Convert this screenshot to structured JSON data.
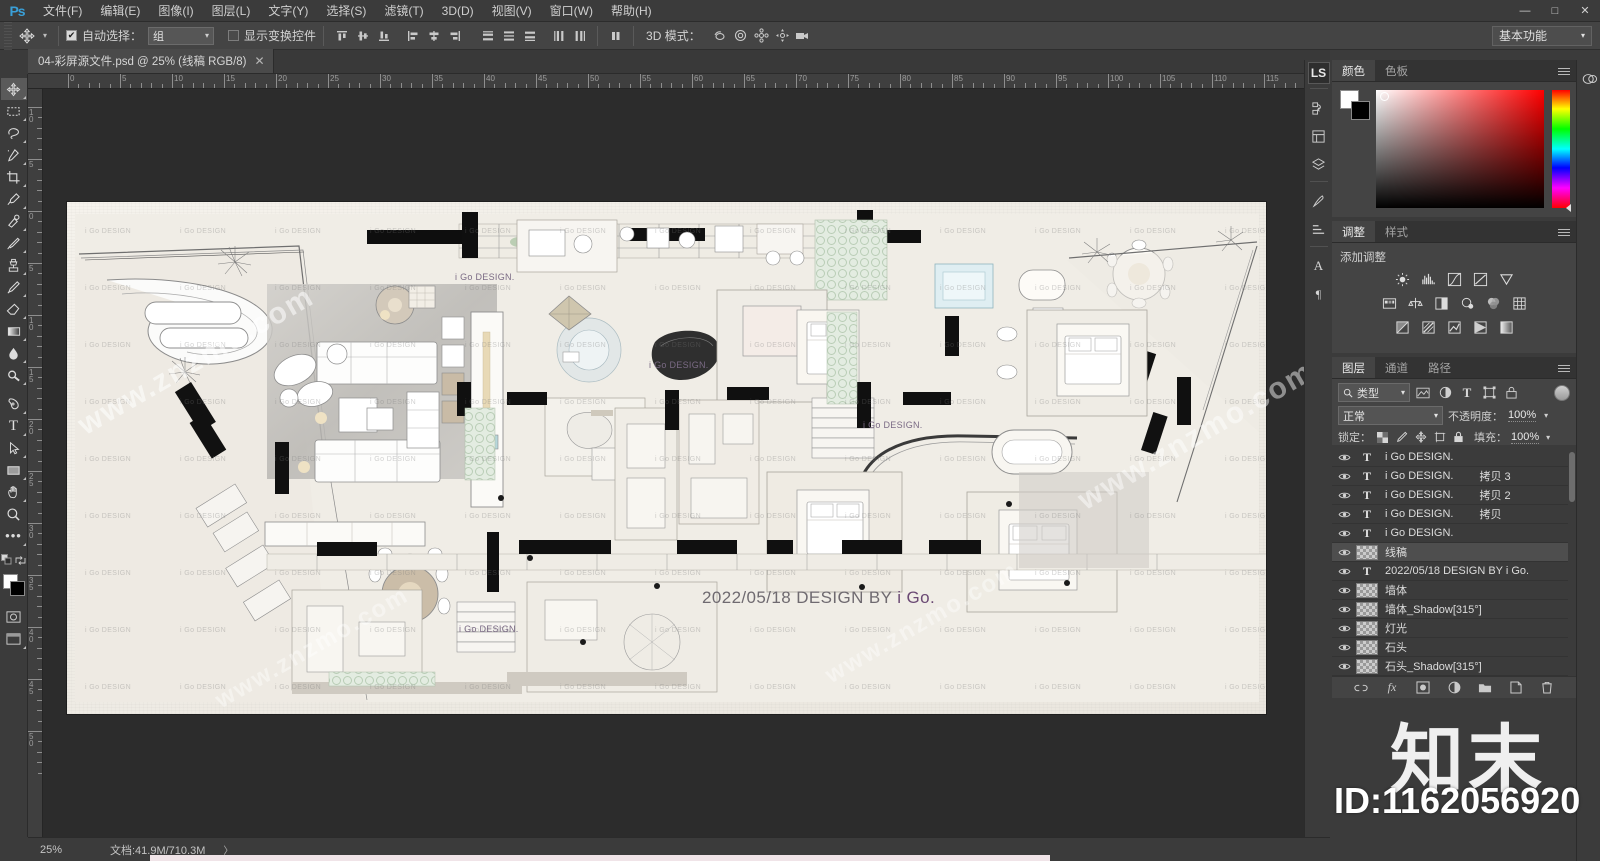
{
  "app": {
    "name": "Photoshop",
    "logo": "Ps"
  },
  "menubar": {
    "items": [
      {
        "label": "文件(F)"
      },
      {
        "label": "编辑(E)"
      },
      {
        "label": "图像(I)"
      },
      {
        "label": "图层(L)"
      },
      {
        "label": "文字(Y)"
      },
      {
        "label": "选择(S)"
      },
      {
        "label": "滤镜(T)"
      },
      {
        "label": "3D(D)"
      },
      {
        "label": "视图(V)"
      },
      {
        "label": "窗口(W)"
      },
      {
        "label": "帮助(H)"
      }
    ],
    "window_controls": [
      "—",
      "□",
      "✕"
    ]
  },
  "options_bar": {
    "active_tool_icon": "move-tool-icon",
    "auto_select_checked": true,
    "auto_select_label": "自动选择：",
    "auto_select_value": "组",
    "show_transform_label": "显示变换控件",
    "show_transform_checked": false,
    "three_d_label": "3D 模式：",
    "workspace": "基本功能",
    "align_icons": [
      "align-top-edges-icon",
      "align-vertical-centers-icon",
      "align-bottom-edges-icon",
      "align-left-edges-icon",
      "align-horizontal-centers-icon",
      "align-right-edges-icon",
      "distribute-top-icon",
      "distribute-vertical-center-icon",
      "distribute-bottom-icon",
      "distribute-left-icon",
      "distribute-right-icon"
    ],
    "extra_icons": [
      "align-options-icon"
    ],
    "three_d_icons": [
      "3d-orbit-icon",
      "3d-roll-icon",
      "3d-pan-icon",
      "3d-slide-icon",
      "3d-camera-icon"
    ]
  },
  "document_tab": {
    "title": "04-彩屏源文件.psd @ 25% (线稿  RGB/8)",
    "close": "✕"
  },
  "toolbar": {
    "tools": [
      {
        "name": "move-tool",
        "selected": true
      },
      {
        "name": "rectangular-marquee-tool",
        "selected": false
      },
      {
        "name": "lasso-tool",
        "selected": false
      },
      {
        "name": "quick-selection-tool",
        "selected": false
      },
      {
        "name": "crop-tool",
        "selected": false
      },
      {
        "name": "eyedropper-tool",
        "selected": false
      },
      {
        "name": "spot-healing-brush-tool",
        "selected": false
      },
      {
        "name": "brush-tool",
        "selected": false
      },
      {
        "name": "clone-stamp-tool",
        "selected": false
      },
      {
        "name": "history-brush-tool",
        "selected": false
      },
      {
        "name": "eraser-tool",
        "selected": false
      },
      {
        "name": "gradient-tool",
        "selected": false
      },
      {
        "name": "blur-tool",
        "selected": false
      },
      {
        "name": "dodge-tool",
        "selected": false
      },
      {
        "name": "pen-tool",
        "selected": false
      },
      {
        "name": "horizontal-type-tool",
        "selected": false
      },
      {
        "name": "path-selection-tool",
        "selected": false
      },
      {
        "name": "rectangle-tool",
        "selected": false
      },
      {
        "name": "hand-tool",
        "selected": false
      },
      {
        "name": "zoom-tool",
        "selected": false
      },
      {
        "name": "edit-toolbar-tool",
        "selected": false
      }
    ],
    "foreground_color": "#ffffff",
    "background_color": "#000000"
  },
  "rulers": {
    "unit_spacing_px": 52,
    "horizontal_labels": [
      "0",
      "5",
      "10",
      "15",
      "20",
      "25",
      "30",
      "35",
      "40",
      "45",
      "50",
      "55",
      "60",
      "65",
      "70",
      "75",
      "80",
      "85",
      "90",
      "95",
      "100",
      "105",
      "110",
      "115"
    ],
    "vertical_labels": [
      "10",
      "5",
      "0",
      "5",
      "10",
      "15",
      "20",
      "25",
      "30",
      "35",
      "40",
      "45",
      "50"
    ]
  },
  "canvas": {
    "credit_text": "2022/05/18 DESIGN BY ",
    "credit_brand": "i Go.",
    "watermark_text": "i Go DESIGN",
    "plan_labels": [
      "i Go DESIGN.",
      "i Go DESIGN.",
      "i Go DESIGN.",
      "i Go DESIGN."
    ],
    "site_watermark": "www.znzmo.com",
    "big_watermark": "知末"
  },
  "status_bar": {
    "zoom": "25%",
    "doc_info": "文档:41.9M/710.3M",
    "arrow": "〉"
  },
  "right_strip": {
    "items": [
      {
        "name": "libraries-badge",
        "label": "LS"
      },
      {
        "name": "history-icon"
      },
      {
        "name": "properties-icon"
      },
      {
        "name": "layer-comps-icon"
      },
      {
        "name": "brush-settings-icon"
      },
      {
        "name": "character-panel-icon",
        "label": "A"
      },
      {
        "name": "paragraph-panel-icon",
        "label": "¶"
      }
    ],
    "cc_libraries_icon": "creative-cloud-icon"
  },
  "color_panel": {
    "tabs": [
      {
        "label": "颜色",
        "active": true
      },
      {
        "label": "色板",
        "active": false
      }
    ],
    "foreground": "#ffffff",
    "background": "#000000"
  },
  "adjustments_panel": {
    "tabs": [
      {
        "label": "调整",
        "active": true
      },
      {
        "label": "样式",
        "active": false
      }
    ],
    "title": "添加调整",
    "row1": [
      "brightness-contrast-icon",
      "levels-icon",
      "curves-icon",
      "exposure-icon",
      "vibrance-icon"
    ],
    "row2": [
      "hue-saturation-icon",
      "color-balance-icon",
      "black-white-icon",
      "photo-filter-icon",
      "channel-mixer-icon",
      "color-lookup-icon"
    ],
    "row3": [
      "invert-icon",
      "posterize-icon",
      "threshold-icon",
      "gradient-map-icon",
      "selective-color-icon"
    ]
  },
  "layers_panel": {
    "tabs": [
      {
        "label": "图层",
        "active": true
      },
      {
        "label": "通道",
        "active": false
      },
      {
        "label": "路径",
        "active": false
      }
    ],
    "filter_label": "类型",
    "filter_icons": [
      "filter-pixel-icon",
      "filter-adjustment-icon",
      "filter-type-icon",
      "filter-shape-icon",
      "filter-smart-icon"
    ],
    "blend_mode": "正常",
    "opacity_label": "不透明度：",
    "opacity_value": "100%",
    "lock_label": "锁定：",
    "lock_icons": [
      "lock-transparent-pixels-icon",
      "lock-image-pixels-icon",
      "lock-position-icon",
      "lock-artboard-nesting-icon",
      "lock-all-icon"
    ],
    "fill_label": "填充：",
    "fill_value": "100%",
    "layers": [
      {
        "name": "i Go DESIGN.",
        "copy": "",
        "kind": "text",
        "visible": true,
        "selected": false
      },
      {
        "name": "i Go DESIGN.",
        "copy": "拷贝 3",
        "kind": "text",
        "visible": true,
        "selected": false
      },
      {
        "name": "i Go DESIGN.",
        "copy": "拷贝 2",
        "kind": "text",
        "visible": true,
        "selected": false
      },
      {
        "name": "i Go DESIGN.",
        "copy": "拷贝",
        "kind": "text",
        "visible": true,
        "selected": false
      },
      {
        "name": "i Go DESIGN.",
        "copy": "",
        "kind": "text",
        "visible": true,
        "selected": false
      },
      {
        "name": "线稿",
        "copy": "",
        "kind": "pixel",
        "visible": true,
        "selected": true
      },
      {
        "name": "2022/05/18 DESIGN BY i Go.",
        "copy": "",
        "kind": "text",
        "visible": true,
        "selected": false
      },
      {
        "name": "墙体",
        "copy": "",
        "kind": "pixel",
        "visible": true,
        "selected": false
      },
      {
        "name": "墙体_Shadow[315°]",
        "copy": "",
        "kind": "pixel",
        "visible": true,
        "selected": false
      },
      {
        "name": "灯光",
        "copy": "",
        "kind": "pixel",
        "visible": true,
        "selected": false
      },
      {
        "name": "石头",
        "copy": "",
        "kind": "pixel",
        "visible": true,
        "selected": false
      },
      {
        "name": "石头_Shadow[315°]",
        "copy": "",
        "kind": "pixel",
        "visible": true,
        "selected": false
      }
    ],
    "footer_icons": [
      "link-layers-icon",
      "layer-style-icon",
      "layer-mask-icon",
      "new-fill-adjustment-icon",
      "new-group-icon",
      "new-layer-icon",
      "delete-layer-icon"
    ],
    "footer_fx_label": "fx"
  },
  "watermarks": {
    "id": "ID:1162056920",
    "cn": "知末",
    "site": "www.znzmo.com"
  },
  "colors": {
    "chrome": "#3b3b3b",
    "panel": "#444444",
    "accent_blue": "#3aa0d8",
    "canvas_bg": "#2c2c2c",
    "paper": "#f2efe9"
  }
}
